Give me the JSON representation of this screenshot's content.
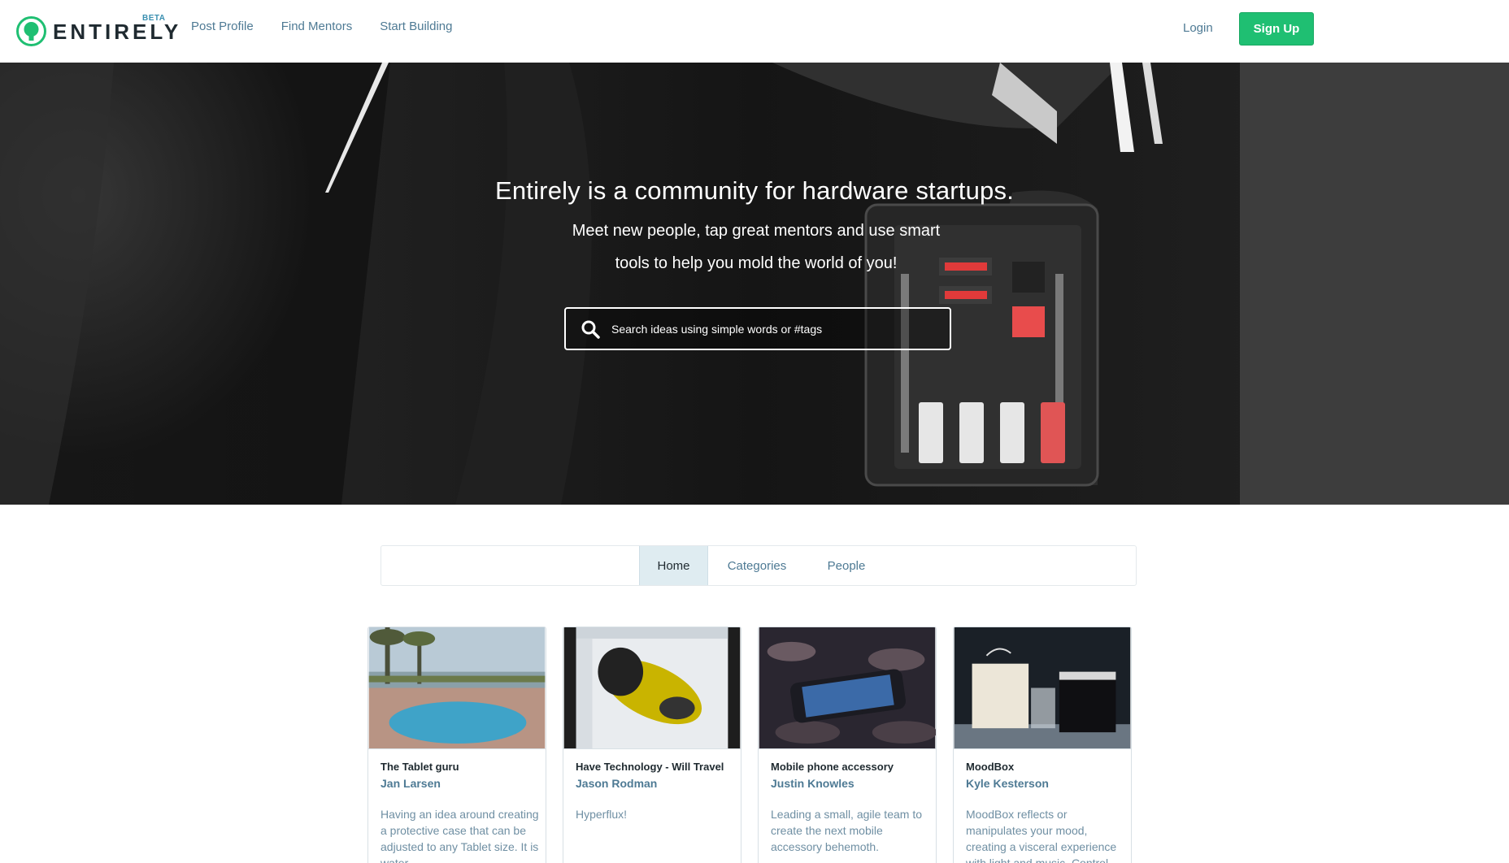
{
  "header": {
    "brand": "ENTIRELY",
    "badge": "BETA",
    "nav": [
      "Post Profile",
      "Find Mentors",
      "Start Building"
    ],
    "login": "Login",
    "signup": "Sign Up",
    "accent_color": "#1fbf72"
  },
  "hero": {
    "title": "Entirely is a community for hardware startups.",
    "subtitle": "Meet new people, tap great mentors and use smart tools to help you mold the world of you!",
    "search_placeholder": "Search ideas using simple words or #tags"
  },
  "tabs": [
    "Home",
    "Categories",
    "People"
  ],
  "active_tab": "Home",
  "cards": [
    {
      "title": "The Tablet guru",
      "author": "Jan Larsen",
      "description": "Having an idea around creating a protective case that can be adjusted to any Tablet size. It is water"
    },
    {
      "title": "Have Technology - Will Travel",
      "author": "Jason Rodman",
      "description": "Hyperflux!"
    },
    {
      "title": "Mobile phone accessory",
      "author": "Justin Knowles",
      "description": "Leading a small, agile team to create the next mobile accessory behemoth."
    },
    {
      "title": "MoodBox",
      "author": "Kyle Kesterson",
      "description": "MoodBox reflects or manipulates your mood, creating a visceral experience with light and music. Control"
    }
  ]
}
